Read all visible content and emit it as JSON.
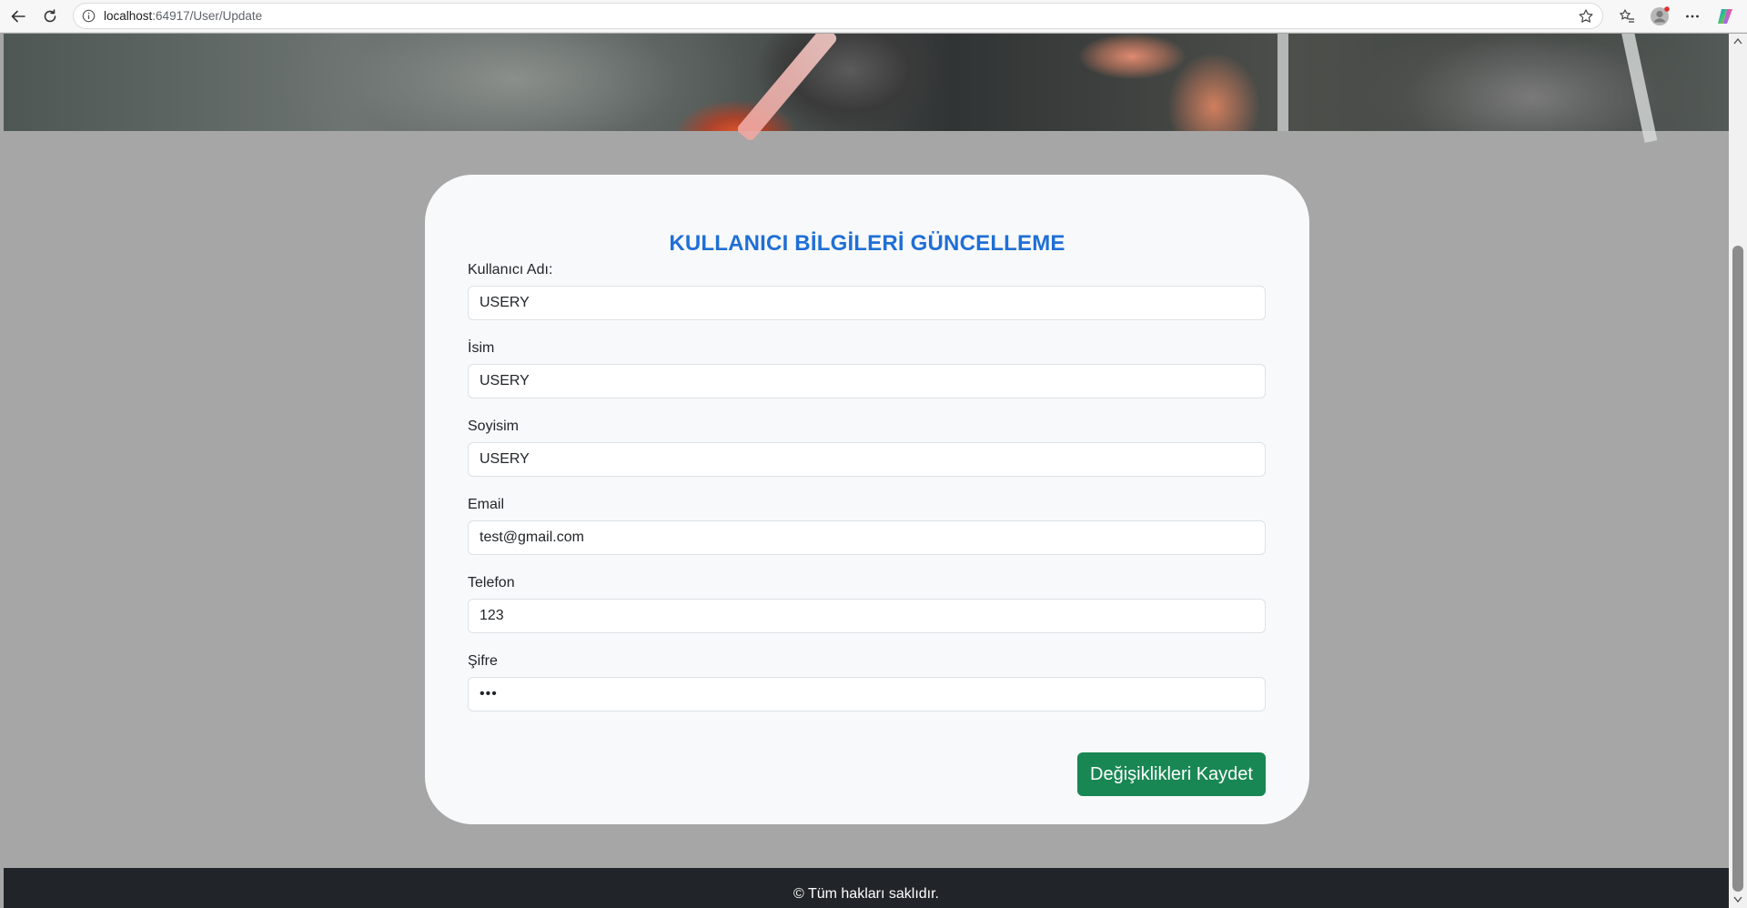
{
  "browser": {
    "url_host": "localhost",
    "url_path": ":64917/User/Update"
  },
  "form": {
    "title": "KULLANICI BİLGİLERİ GÜNCELLEME",
    "fields": [
      {
        "label": "Kullanıcı Adı:",
        "value": "USERY"
      },
      {
        "label": "İsim",
        "value": "USERY"
      },
      {
        "label": "Soyisim",
        "value": "USERY"
      },
      {
        "label": "Email",
        "value": "test@gmail.com"
      },
      {
        "label": "Telefon",
        "value": "123"
      },
      {
        "label": "Şifre",
        "value": "•••"
      }
    ],
    "submit_label": "Değişiklikleri Kaydet"
  },
  "footer": {
    "text": "© Tüm hakları saklıdır."
  },
  "colors": {
    "title": "#1f6fd6",
    "button": "#198754",
    "page_bg": "#a6a6a6",
    "footer_bg": "#212529"
  },
  "icons": {
    "back": "back-arrow-icon",
    "reload": "reload-icon",
    "info": "info-icon",
    "favorite": "star-icon",
    "favorites_list": "favorites-icon",
    "profile": "profile-icon",
    "menu": "more-icon",
    "copilot": "copilot-icon"
  }
}
